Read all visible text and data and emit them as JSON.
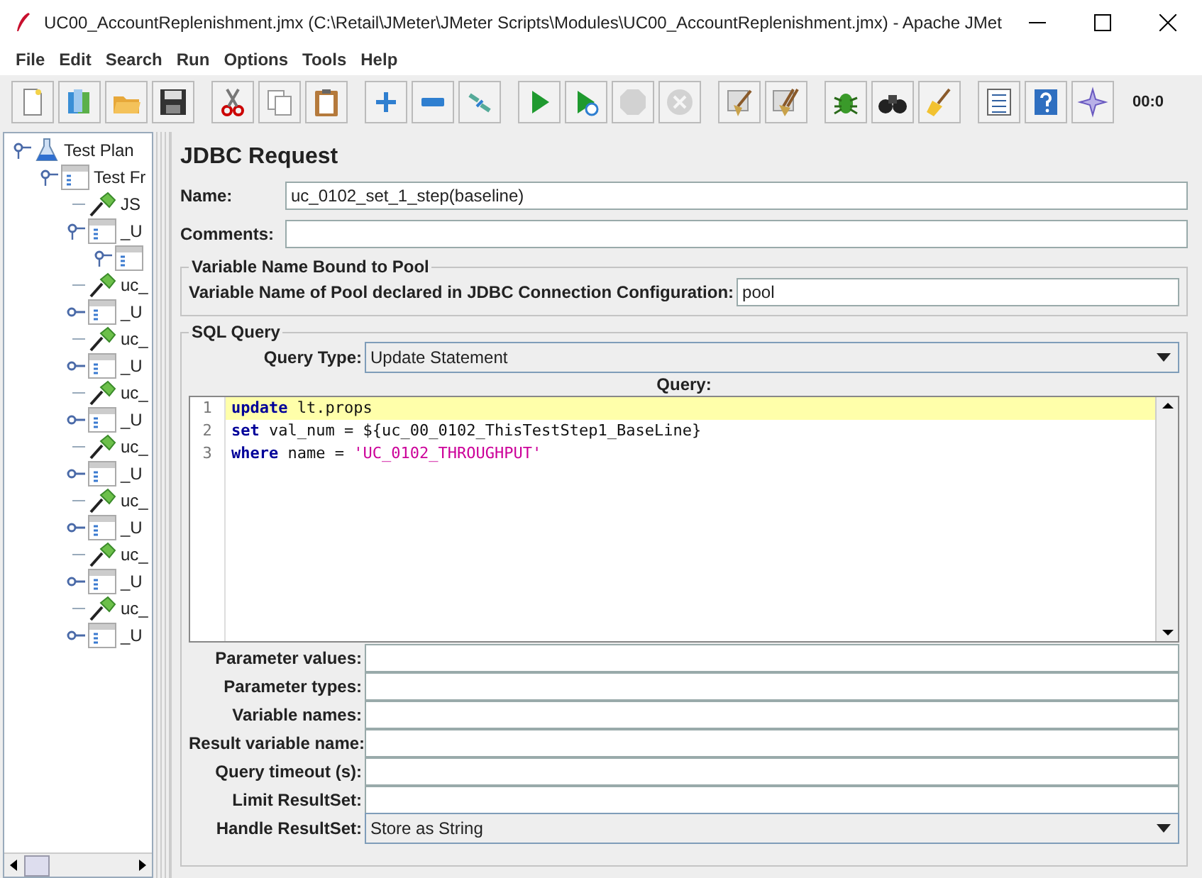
{
  "window": {
    "title": "UC00_AccountReplenishment.jmx (C:\\Retail\\JMeter\\JMeter Scripts\\Modules\\UC00_AccountReplenishment.jmx) - Apache JMet"
  },
  "menu": [
    "File",
    "Edit",
    "Search",
    "Run",
    "Options",
    "Tools",
    "Help"
  ],
  "toolbar": [
    {
      "kind": "new",
      "disabled": false,
      "group_start": false
    },
    {
      "kind": "templates",
      "disabled": false,
      "group_start": false
    },
    {
      "kind": "open",
      "disabled": false,
      "group_start": false
    },
    {
      "kind": "save",
      "disabled": false,
      "group_start": false
    },
    {
      "kind": "cut",
      "disabled": false,
      "group_start": true
    },
    {
      "kind": "copy",
      "disabled": false,
      "group_start": false
    },
    {
      "kind": "paste",
      "disabled": false,
      "group_start": false
    },
    {
      "kind": "expand",
      "disabled": false,
      "group_start": true
    },
    {
      "kind": "collapse",
      "disabled": false,
      "group_start": false
    },
    {
      "kind": "toggle",
      "disabled": false,
      "group_start": false
    },
    {
      "kind": "start",
      "disabled": false,
      "group_start": true
    },
    {
      "kind": "start-no-pause",
      "disabled": false,
      "group_start": false
    },
    {
      "kind": "stop",
      "disabled": true,
      "group_start": false
    },
    {
      "kind": "shutdown",
      "disabled": true,
      "group_start": false
    },
    {
      "kind": "clear",
      "disabled": false,
      "group_start": true
    },
    {
      "kind": "clear-all",
      "disabled": false,
      "group_start": false
    },
    {
      "kind": "function",
      "disabled": false,
      "group_start": true
    },
    {
      "kind": "search",
      "disabled": false,
      "group_start": false
    },
    {
      "kind": "reset",
      "disabled": false,
      "group_start": false
    },
    {
      "kind": "log",
      "disabled": false,
      "group_start": true
    },
    {
      "kind": "help",
      "disabled": false,
      "group_start": false
    },
    {
      "kind": "remote",
      "disabled": false,
      "group_start": false
    }
  ],
  "timer": "00:0",
  "tree": [
    {
      "label": "Test Plan",
      "kind": "plan",
      "expanded": true,
      "children": [
        {
          "label": "Test Fr",
          "kind": "controller",
          "expanded": true,
          "children": [
            {
              "label": "JS",
              "kind": "sampler"
            },
            {
              "label": "_U",
              "kind": "controller",
              "expanded": true,
              "children": [
                {
                  "kind": "controller",
                  "expanded": true
                }
              ]
            },
            {
              "label": "uc_",
              "kind": "sampler"
            },
            {
              "label": "_U",
              "kind": "controller",
              "expanded": false
            },
            {
              "label": "uc_",
              "kind": "sampler"
            },
            {
              "label": "_U",
              "kind": "controller",
              "expanded": false
            },
            {
              "label": "uc_",
              "kind": "sampler"
            },
            {
              "label": "_U",
              "kind": "controller",
              "expanded": false
            },
            {
              "label": "uc_",
              "kind": "sampler"
            },
            {
              "label": "_U",
              "kind": "controller",
              "expanded": false
            },
            {
              "label": "uc_",
              "kind": "sampler"
            },
            {
              "label": "_U",
              "kind": "controller",
              "expanded": false
            },
            {
              "label": "uc_",
              "kind": "sampler"
            },
            {
              "label": "_U",
              "kind": "controller",
              "expanded": false
            },
            {
              "label": "uc_",
              "kind": "sampler"
            },
            {
              "label": "_U",
              "kind": "controller",
              "expanded": false
            }
          ]
        }
      ]
    }
  ],
  "panel": {
    "title": "JDBC Request",
    "name": {
      "label": "Name:",
      "value": "uc_0102_set_1_step(baseline)"
    },
    "comments": {
      "label": "Comments:"
    },
    "pool_group": {
      "title": "Variable Name Bound to Pool",
      "label": "Variable Name of Pool declared in JDBC Connection Configuration:",
      "value": "pool"
    },
    "sql_group": {
      "title": "SQL Query",
      "query_type": {
        "label": "Query Type:",
        "value": "Update Statement"
      },
      "query_label": "Query:",
      "query_lines": [
        {
          "number": "1",
          "current": true,
          "tokens": [
            {
              "kind": "keyword",
              "text": "update"
            },
            {
              "kind": "plain",
              "text": " lt.props"
            }
          ]
        },
        {
          "number": "2",
          "current": false,
          "tokens": [
            {
              "kind": "keyword",
              "text": "set"
            },
            {
              "kind": "plain",
              "text": " val_num = ${uc_00_0102_ThisTestStep1_BaseLine}"
            }
          ]
        },
        {
          "number": "3",
          "current": false,
          "tokens": [
            {
              "kind": "keyword",
              "text": "where"
            },
            {
              "kind": "plain",
              "text": " name = "
            },
            {
              "kind": "string",
              "text": "'UC_0102_THROUGHPUT'"
            }
          ]
        }
      ],
      "fields": [
        {
          "kind": "text",
          "label": "Parameter values:"
        },
        {
          "kind": "text",
          "label": "Parameter types:"
        },
        {
          "kind": "text",
          "label": "Variable names:"
        },
        {
          "kind": "text",
          "label": "Result variable name:"
        },
        {
          "kind": "text",
          "label": "Query timeout (s):"
        },
        {
          "kind": "text",
          "label": "Limit ResultSet:"
        },
        {
          "kind": "select",
          "label": "Handle ResultSet:",
          "value": "Store as String"
        }
      ]
    }
  }
}
